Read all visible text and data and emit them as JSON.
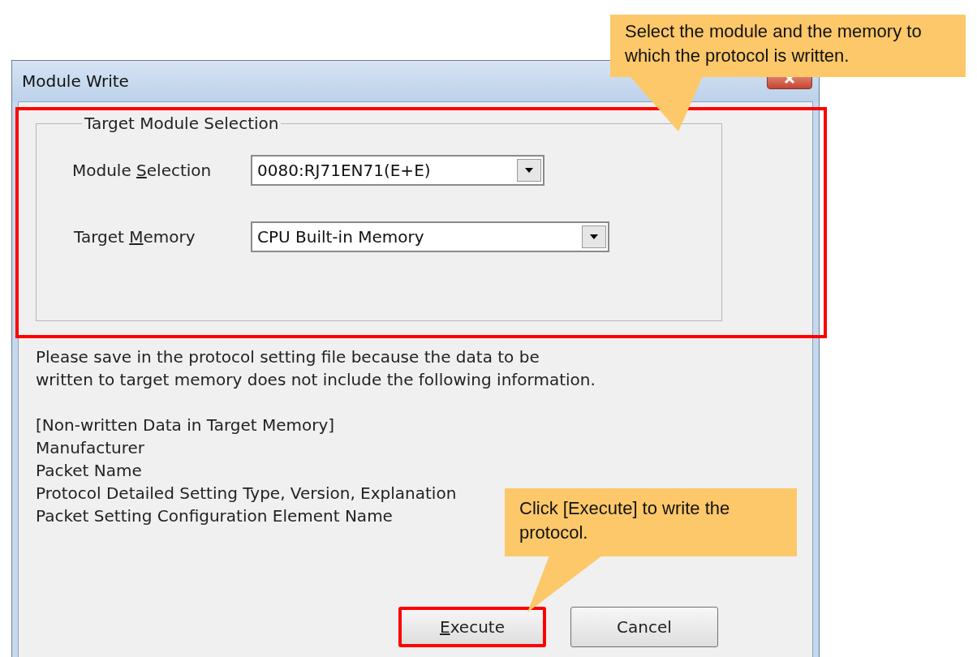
{
  "window": {
    "title": "Module Write"
  },
  "target_module_selection": {
    "title": "Target Module Selection",
    "highlighted": true,
    "fields": [
      {
        "label": {
          "before": "Module ",
          "key": "S",
          "after": "election"
        },
        "value": "0080:RJ71EN71(E+E)"
      },
      {
        "label": {
          "before": "Target ",
          "key": "M",
          "after": "emory"
        },
        "value": "CPU Built-in Memory"
      }
    ]
  },
  "message_lines": [
    "Please save in the protocol setting file because the data to be",
    "written to target memory does not include the following information."
  ],
  "non_written_data": {
    "heading": "[Non-written Data in Target Memory]",
    "items": [
      "Manufacturer",
      "Packet Name",
      "Protocol Detailed Setting Type, Version, Explanation",
      "Packet Setting Configuration Element Name"
    ]
  },
  "buttons": [
    {
      "label": {
        "key": "E",
        "after": "xecute"
      },
      "highlighted": true
    },
    {
      "label": {
        "before": "Cancel"
      },
      "highlighted": false
    }
  ],
  "callouts": [
    {
      "text": "Select the module and the memory to which the protocol is written."
    },
    {
      "text": "Click [Execute] to write the protocol."
    }
  ]
}
